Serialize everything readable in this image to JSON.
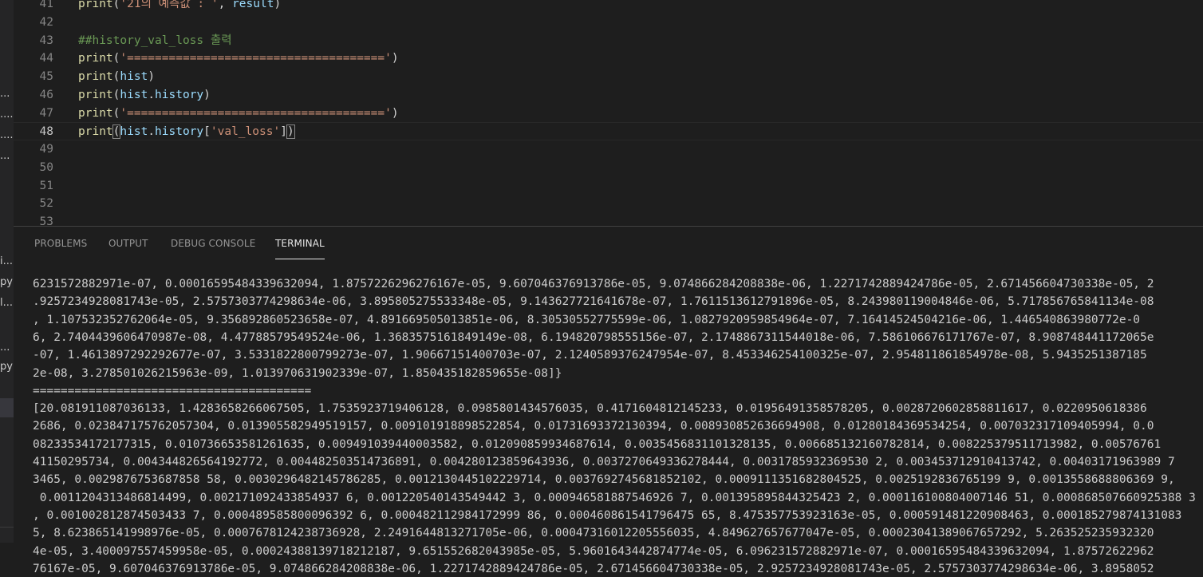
{
  "editor": {
    "lines": [
      {
        "number": "41",
        "segments": [
          {
            "t": "print",
            "c": "fn"
          },
          {
            "t": "(",
            "c": "pu"
          },
          {
            "t": "'21의 예측값 : '",
            "c": "st"
          },
          {
            "t": ", ",
            "c": "pu"
          },
          {
            "t": "result",
            "c": "va"
          },
          {
            "t": ")",
            "c": "pu"
          }
        ]
      },
      {
        "number": "42",
        "segments": []
      },
      {
        "number": "43",
        "segments": [
          {
            "t": "##history_val_loss 출력",
            "c": "cm"
          }
        ]
      },
      {
        "number": "44",
        "segments": [
          {
            "t": "print",
            "c": "fn"
          },
          {
            "t": "(",
            "c": "pu"
          },
          {
            "t": "'====================================='",
            "c": "st"
          },
          {
            "t": ")",
            "c": "pu"
          }
        ]
      },
      {
        "number": "45",
        "segments": [
          {
            "t": "print",
            "c": "fn"
          },
          {
            "t": "(",
            "c": "pu"
          },
          {
            "t": "hist",
            "c": "va"
          },
          {
            "t": ")",
            "c": "pu"
          }
        ]
      },
      {
        "number": "46",
        "segments": [
          {
            "t": "print",
            "c": "fn"
          },
          {
            "t": "(",
            "c": "pu"
          },
          {
            "t": "hist",
            "c": "va"
          },
          {
            "t": ".",
            "c": "pu"
          },
          {
            "t": "history",
            "c": "va"
          },
          {
            "t": ")",
            "c": "pu"
          }
        ]
      },
      {
        "number": "47",
        "segments": [
          {
            "t": "print",
            "c": "fn"
          },
          {
            "t": "(",
            "c": "pu"
          },
          {
            "t": "'====================================='",
            "c": "st"
          },
          {
            "t": ")",
            "c": "pu"
          }
        ]
      },
      {
        "number": "48",
        "segments": [
          {
            "t": "print",
            "c": "fn"
          },
          {
            "t": "(",
            "c": "pu br"
          },
          {
            "t": "hist",
            "c": "va"
          },
          {
            "t": ".",
            "c": "pu"
          },
          {
            "t": "history",
            "c": "va"
          },
          {
            "t": "[",
            "c": "pu"
          },
          {
            "t": "'val_loss'",
            "c": "st"
          },
          {
            "t": "]",
            "c": "pu"
          },
          {
            "t": ")",
            "c": "pu br"
          }
        ],
        "current": true
      },
      {
        "number": "49",
        "segments": []
      },
      {
        "number": "50",
        "segments": []
      },
      {
        "number": "51",
        "segments": []
      },
      {
        "number": "52",
        "segments": []
      },
      {
        "number": "53",
        "segments": []
      }
    ]
  },
  "panel": {
    "tabs": [
      "PROBLEMS",
      "OUTPUT",
      "DEBUG CONSOLE",
      "TERMINAL"
    ],
    "active_tab": "TERMINAL",
    "terminal_lines": [
      "6231572882971e-07, 0.00016595484339632094, 1.8757226296276167e-05, 9.607046376913786e-05, 9.074866284208838e-06, 1.2271742889424786e-05, 2.671456604730338e-05, 2",
      ".9257234928081743e-05, 2.5757303774298634e-06, 3.895805275533348e-05, 9.143627721641678e-07, 1.7611513612791896e-05, 8.243980119004846e-06, 5.717856765841134e-08",
      ", 1.107532352762064e-05, 9.356892860523658e-07, 4.891669505013851e-06, 8.30530552775599e-06, 1.0827920959854964e-07, 7.16414524504216e-06, 1.446540863980772e-0",
      "6, 2.7404439606470987e-08, 4.47788579549524e-06, 1.3683575161849149e-08, 6.194820798555156e-07, 2.1748867311544018e-06, 7.586106676171767e-07, 8.908748441172065e",
      "-07, 1.4613897292292677e-07, 3.5331822800799273e-07, 1.90667151400703e-07, 2.1240589376247954e-07, 8.453346254100325e-07, 2.954811861854978e-08, 5.9435251387185",
      "2e-08, 3.278501026215963e-09, 1.013970631902339e-07, 1.850435182859655e-08]}",
      "========================================",
      "[20.081911087036133, 1.4283658266067505, 1.7535923719406128, 0.0985801434576035, 0.4171604812145233, 0.01956491358578205, 0.0028720602858811617, 0.0220950618386",
      "2686, 0.023847175762057304, 0.013905582949519157, 0.009101918898522854, 0.01731693372130394, 0.008930852636694908, 0.01280184369534254, 0.007032317109405994, 0.0",
      "08233534172177315, 0.010736653581261635, 0.009491039440003582, 0.012090859934687614, 0.0035456831101328135, 0.006685132160782814, 0.008225379511713982, 0.00576761",
      "41150295734, 0.004344826564192772, 0.004482503514736891, 0.004280123859643936, 0.0037270649336278444, 0.0031785932369530 2, 0.003453712910413742, 0.00403171963989 7",
      "3465, 0.0029876753687858 58, 0.0030296482145786285, 0.0012130445102229714, 0.0037692745681852102, 0.0009111351682804525, 0.0025192836765199 9, 0.0013558688806369 9,",
      " 0.0011204313486814499, 0.002171092433854937 6, 0.001220540143549442 3, 0.000946581887546926 7, 0.001395895844325423 2, 0.000116100804007146 51, 0.000868507660925388 3",
      ", 0.001002812874503433 7, 0.000489585800096392 6, 0.000482112984172999 86, 0.000460861541796475 65, 8.475357753923163e-05, 0.000591481220908463, 0.000185279874131083",
      "5, 8.623865141998976e-05, 0.0007678124238736928, 2.2491644813271705e-06, 0.00047316012205556035, 4.849627657677047e-05, 0.00023041389067657292, 5.263525235932320",
      "4e-05, 3.400097557459958e-05, 0.00024388139718212187, 9.651552682043985e-05, 5.9601643442874774e-05, 6.096231572882971e-07, 0.00016595484339632094, 1.87572622962",
      "76167e-05, 9.607046376913786e-05, 9.074866284208838e-06, 1.2271742889424786e-05, 2.671456604730338e-05, 2.9257234928081743e-05, 2.5757303774298634e-06, 3.8958052"
    ]
  },
  "sidebar": {
    "fragments": [
      "...",
      "....",
      "....",
      "...",
      "i...",
      "py",
      "l...",
      "...",
      "py"
    ]
  }
}
